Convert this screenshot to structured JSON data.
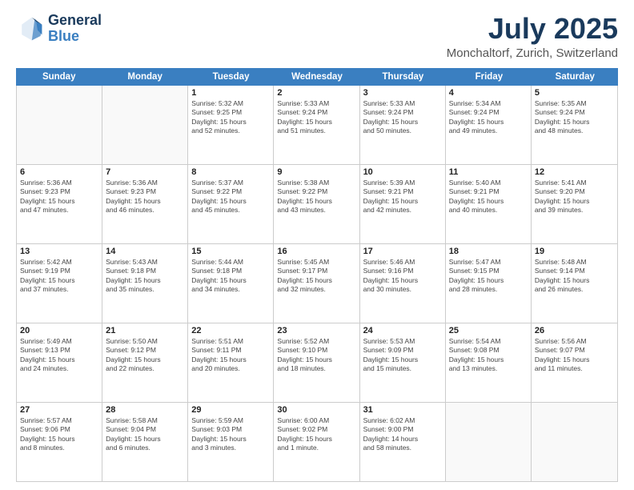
{
  "logo": {
    "line1": "General",
    "line2": "Blue"
  },
  "title": "July 2025",
  "subtitle": "Monchaltorf, Zurich, Switzerland",
  "header_days": [
    "Sunday",
    "Monday",
    "Tuesday",
    "Wednesday",
    "Thursday",
    "Friday",
    "Saturday"
  ],
  "weeks": [
    [
      {
        "day": "",
        "lines": []
      },
      {
        "day": "",
        "lines": []
      },
      {
        "day": "1",
        "lines": [
          "Sunrise: 5:32 AM",
          "Sunset: 9:25 PM",
          "Daylight: 15 hours",
          "and 52 minutes."
        ]
      },
      {
        "day": "2",
        "lines": [
          "Sunrise: 5:33 AM",
          "Sunset: 9:24 PM",
          "Daylight: 15 hours",
          "and 51 minutes."
        ]
      },
      {
        "day": "3",
        "lines": [
          "Sunrise: 5:33 AM",
          "Sunset: 9:24 PM",
          "Daylight: 15 hours",
          "and 50 minutes."
        ]
      },
      {
        "day": "4",
        "lines": [
          "Sunrise: 5:34 AM",
          "Sunset: 9:24 PM",
          "Daylight: 15 hours",
          "and 49 minutes."
        ]
      },
      {
        "day": "5",
        "lines": [
          "Sunrise: 5:35 AM",
          "Sunset: 9:24 PM",
          "Daylight: 15 hours",
          "and 48 minutes."
        ]
      }
    ],
    [
      {
        "day": "6",
        "lines": [
          "Sunrise: 5:36 AM",
          "Sunset: 9:23 PM",
          "Daylight: 15 hours",
          "and 47 minutes."
        ]
      },
      {
        "day": "7",
        "lines": [
          "Sunrise: 5:36 AM",
          "Sunset: 9:23 PM",
          "Daylight: 15 hours",
          "and 46 minutes."
        ]
      },
      {
        "day": "8",
        "lines": [
          "Sunrise: 5:37 AM",
          "Sunset: 9:22 PM",
          "Daylight: 15 hours",
          "and 45 minutes."
        ]
      },
      {
        "day": "9",
        "lines": [
          "Sunrise: 5:38 AM",
          "Sunset: 9:22 PM",
          "Daylight: 15 hours",
          "and 43 minutes."
        ]
      },
      {
        "day": "10",
        "lines": [
          "Sunrise: 5:39 AM",
          "Sunset: 9:21 PM",
          "Daylight: 15 hours",
          "and 42 minutes."
        ]
      },
      {
        "day": "11",
        "lines": [
          "Sunrise: 5:40 AM",
          "Sunset: 9:21 PM",
          "Daylight: 15 hours",
          "and 40 minutes."
        ]
      },
      {
        "day": "12",
        "lines": [
          "Sunrise: 5:41 AM",
          "Sunset: 9:20 PM",
          "Daylight: 15 hours",
          "and 39 minutes."
        ]
      }
    ],
    [
      {
        "day": "13",
        "lines": [
          "Sunrise: 5:42 AM",
          "Sunset: 9:19 PM",
          "Daylight: 15 hours",
          "and 37 minutes."
        ]
      },
      {
        "day": "14",
        "lines": [
          "Sunrise: 5:43 AM",
          "Sunset: 9:18 PM",
          "Daylight: 15 hours",
          "and 35 minutes."
        ]
      },
      {
        "day": "15",
        "lines": [
          "Sunrise: 5:44 AM",
          "Sunset: 9:18 PM",
          "Daylight: 15 hours",
          "and 34 minutes."
        ]
      },
      {
        "day": "16",
        "lines": [
          "Sunrise: 5:45 AM",
          "Sunset: 9:17 PM",
          "Daylight: 15 hours",
          "and 32 minutes."
        ]
      },
      {
        "day": "17",
        "lines": [
          "Sunrise: 5:46 AM",
          "Sunset: 9:16 PM",
          "Daylight: 15 hours",
          "and 30 minutes."
        ]
      },
      {
        "day": "18",
        "lines": [
          "Sunrise: 5:47 AM",
          "Sunset: 9:15 PM",
          "Daylight: 15 hours",
          "and 28 minutes."
        ]
      },
      {
        "day": "19",
        "lines": [
          "Sunrise: 5:48 AM",
          "Sunset: 9:14 PM",
          "Daylight: 15 hours",
          "and 26 minutes."
        ]
      }
    ],
    [
      {
        "day": "20",
        "lines": [
          "Sunrise: 5:49 AM",
          "Sunset: 9:13 PM",
          "Daylight: 15 hours",
          "and 24 minutes."
        ]
      },
      {
        "day": "21",
        "lines": [
          "Sunrise: 5:50 AM",
          "Sunset: 9:12 PM",
          "Daylight: 15 hours",
          "and 22 minutes."
        ]
      },
      {
        "day": "22",
        "lines": [
          "Sunrise: 5:51 AM",
          "Sunset: 9:11 PM",
          "Daylight: 15 hours",
          "and 20 minutes."
        ]
      },
      {
        "day": "23",
        "lines": [
          "Sunrise: 5:52 AM",
          "Sunset: 9:10 PM",
          "Daylight: 15 hours",
          "and 18 minutes."
        ]
      },
      {
        "day": "24",
        "lines": [
          "Sunrise: 5:53 AM",
          "Sunset: 9:09 PM",
          "Daylight: 15 hours",
          "and 15 minutes."
        ]
      },
      {
        "day": "25",
        "lines": [
          "Sunrise: 5:54 AM",
          "Sunset: 9:08 PM",
          "Daylight: 15 hours",
          "and 13 minutes."
        ]
      },
      {
        "day": "26",
        "lines": [
          "Sunrise: 5:56 AM",
          "Sunset: 9:07 PM",
          "Daylight: 15 hours",
          "and 11 minutes."
        ]
      }
    ],
    [
      {
        "day": "27",
        "lines": [
          "Sunrise: 5:57 AM",
          "Sunset: 9:06 PM",
          "Daylight: 15 hours",
          "and 8 minutes."
        ]
      },
      {
        "day": "28",
        "lines": [
          "Sunrise: 5:58 AM",
          "Sunset: 9:04 PM",
          "Daylight: 15 hours",
          "and 6 minutes."
        ]
      },
      {
        "day": "29",
        "lines": [
          "Sunrise: 5:59 AM",
          "Sunset: 9:03 PM",
          "Daylight: 15 hours",
          "and 3 minutes."
        ]
      },
      {
        "day": "30",
        "lines": [
          "Sunrise: 6:00 AM",
          "Sunset: 9:02 PM",
          "Daylight: 15 hours",
          "and 1 minute."
        ]
      },
      {
        "day": "31",
        "lines": [
          "Sunrise: 6:02 AM",
          "Sunset: 9:00 PM",
          "Daylight: 14 hours",
          "and 58 minutes."
        ]
      },
      {
        "day": "",
        "lines": []
      },
      {
        "day": "",
        "lines": []
      }
    ]
  ]
}
